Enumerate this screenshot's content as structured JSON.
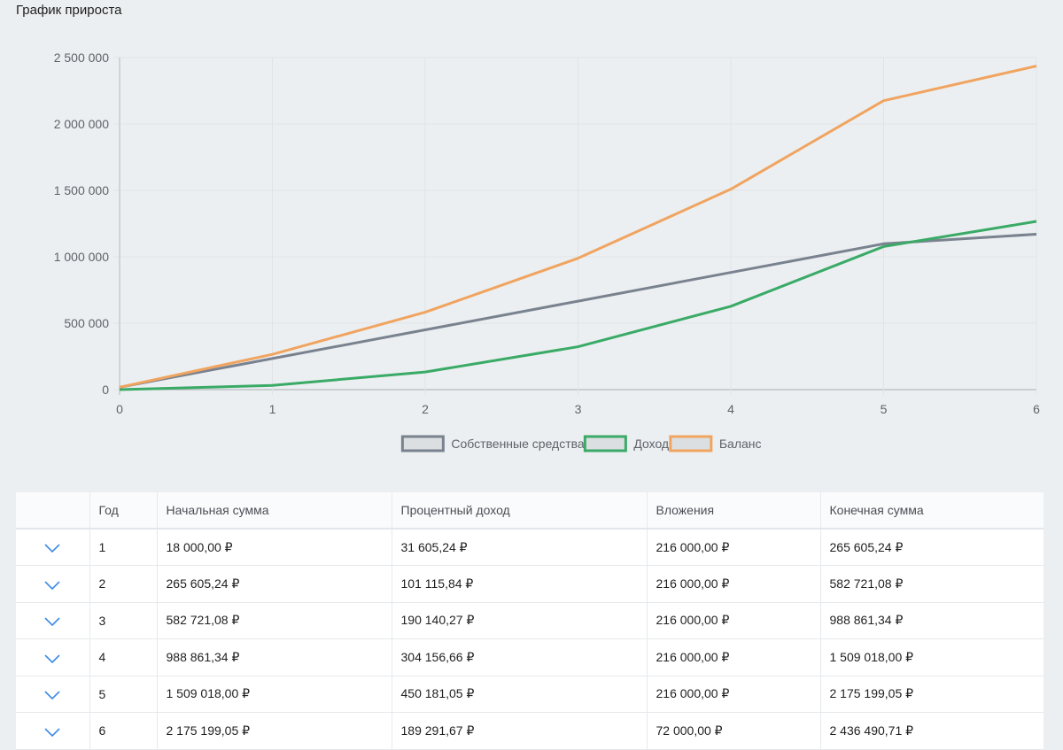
{
  "page_title": "График прироста",
  "colors": {
    "own_funds": "#79828f",
    "income": "#3aaa67",
    "balance": "#f0a460",
    "grid": "#e1e4e7",
    "axis": "#b5b9be",
    "chevron": "#3c8ce6"
  },
  "chart_data": {
    "type": "line",
    "title": "График прироста",
    "x": [
      0,
      1,
      2,
      3,
      4,
      5,
      6
    ],
    "xlim": [
      0,
      6
    ],
    "ylim": [
      0,
      2500000
    ],
    "y_ticks": [
      0,
      500000,
      1000000,
      1500000,
      2000000,
      2500000
    ],
    "y_tick_labels": [
      "0",
      "500 000",
      "1 000 000",
      "1 500 000",
      "2 000 000",
      "2 500 000"
    ],
    "x_tick_labels": [
      "0",
      "1",
      "2",
      "3",
      "4",
      "5",
      "6"
    ],
    "grid": true,
    "legend_position": "bottom",
    "series": [
      {
        "name": "Собственные средства",
        "color": "#79828f",
        "values": [
          18000,
          234000,
          450000,
          666000,
          882000,
          1098000,
          1170000
        ]
      },
      {
        "name": "Доход",
        "color": "#3aaa67",
        "values": [
          0,
          31605.24,
          132721.08,
          322861.35,
          627018,
          1077199.05,
          1266490.72
        ]
      },
      {
        "name": "Баланс",
        "color": "#f0a460",
        "values": [
          18000,
          265605.24,
          582721.08,
          988861.34,
          1509018,
          2175199.05,
          2436490.71
        ]
      }
    ]
  },
  "table": {
    "columns": [
      "",
      "Год",
      "Начальная сумма",
      "Процентный доход",
      "Вложения",
      "Конечная сумма"
    ],
    "rows": [
      [
        "1",
        "18 000,00 ₽",
        "31 605,24 ₽",
        "216 000,00 ₽",
        "265 605,24 ₽"
      ],
      [
        "2",
        "265 605,24 ₽",
        "101 115,84 ₽",
        "216 000,00 ₽",
        "582 721,08 ₽"
      ],
      [
        "3",
        "582 721,08 ₽",
        "190 140,27 ₽",
        "216 000,00 ₽",
        "988 861,34 ₽"
      ],
      [
        "4",
        "988 861,34 ₽",
        "304 156,66 ₽",
        "216 000,00 ₽",
        "1 509 018,00 ₽"
      ],
      [
        "5",
        "1 509 018,00 ₽",
        "450 181,05 ₽",
        "216 000,00 ₽",
        "2 175 199,05 ₽"
      ],
      [
        "6",
        "2 175 199,05 ₽",
        "189 291,67 ₽",
        "72 000,00 ₽",
        "2 436 490,71 ₽"
      ]
    ]
  }
}
